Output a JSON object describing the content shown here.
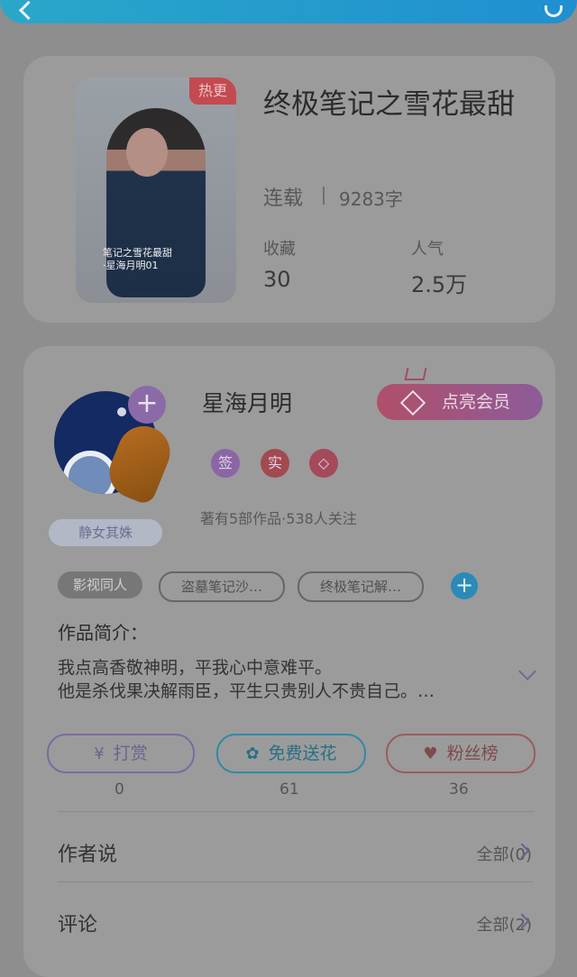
{
  "book": {
    "hot_label": "热更",
    "title": "终极笔记之雪花最甜",
    "status": "连载",
    "words": "9283字",
    "stats": [
      {
        "label": "收藏",
        "value": "30"
      },
      {
        "label": "人气",
        "value": "2.5万"
      }
    ]
  },
  "author": {
    "name": "星海月明",
    "vip_button": "点亮会员",
    "badge": "静女其姝",
    "icons": [
      {
        "label": "签",
        "color": "#8b66a6"
      },
      {
        "label": "实",
        "color": "#a34950"
      },
      {
        "label": "",
        "color": "#a54a5a"
      }
    ],
    "works": "著有5部作品·538人关注",
    "tags": [
      "影视同人",
      "盗墓笔记沙…",
      "终极笔记解…"
    ],
    "intro_title": "作品简介：",
    "intro_lines": [
      "我点高香敬神明，平我心中意难平。",
      "他是杀伐果决解雨臣，平生只贵别人不贵自己。…"
    ],
    "actions": [
      {
        "label": "打赏",
        "count": "0",
        "icon": "yen-icon",
        "color": "#7c6a9f"
      },
      {
        "label": "免费送花",
        "count": "61",
        "icon": "flower-icon",
        "color": "#2f8aa7"
      },
      {
        "label": "粉丝榜",
        "count": "36",
        "icon": "fans-icon",
        "color": "#9b5b5e"
      }
    ],
    "sections": [
      {
        "title": "作者说",
        "action": "全部(0)"
      },
      {
        "title": "评论",
        "action": "全部(2)"
      }
    ]
  }
}
